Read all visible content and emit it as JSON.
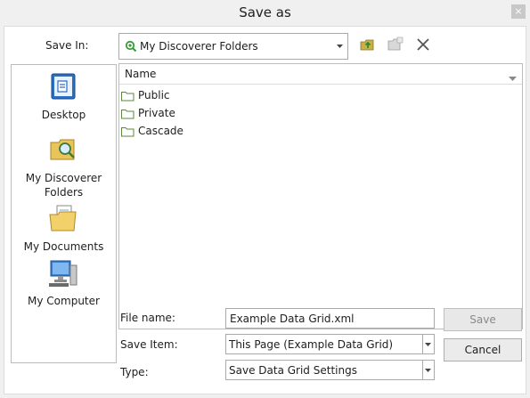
{
  "window": {
    "title": "Save as",
    "close_glyph": "×"
  },
  "save_in": {
    "label": "Save In:",
    "value": "My Discoverer Folders",
    "icon": "discoverer-folders-icon",
    "toolbar": [
      {
        "name": "up-folder-icon"
      },
      {
        "name": "new-folder-icon"
      },
      {
        "name": "delete-icon"
      }
    ]
  },
  "places": [
    {
      "label": "Desktop",
      "icon": "desktop-icon"
    },
    {
      "label": "My Discoverer Folders",
      "icon": "discoverer-folders-icon"
    },
    {
      "label": "My Documents",
      "icon": "documents-icon"
    },
    {
      "label": "My Computer",
      "icon": "computer-icon"
    }
  ],
  "file_list": {
    "column_header": "Name",
    "folders": [
      "Public",
      "Private",
      "Cascade"
    ]
  },
  "file_name": {
    "label": "File name:",
    "value": "Example Data Grid.xml"
  },
  "save_item": {
    "label": "Save Item:",
    "value": "This Page (Example Data Grid)"
  },
  "type": {
    "label": "Type:",
    "value": "Save Data Grid Settings"
  },
  "buttons": {
    "save": "Save",
    "cancel": "Cancel"
  },
  "colors": {
    "folder_outline": "#5a8a3a",
    "accent_green": "#3a9a3a",
    "dialog_bg": "#f0f0f0"
  }
}
